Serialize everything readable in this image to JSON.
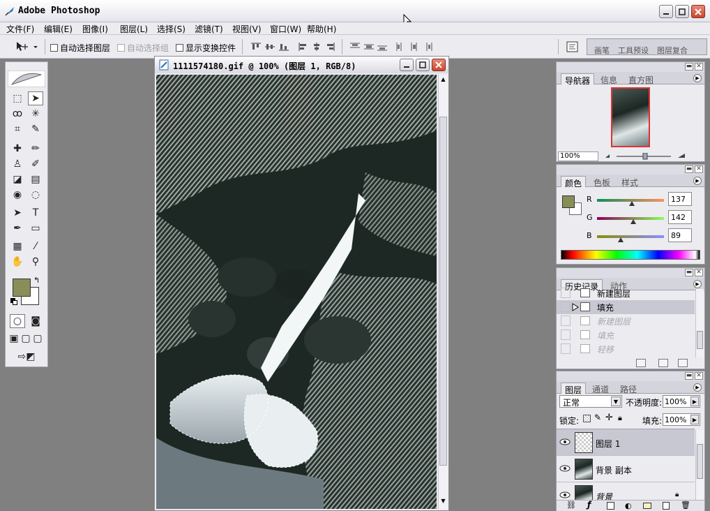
{
  "window": {
    "title": "Adobe Photoshop"
  },
  "menu": [
    "文件(F)",
    "编辑(E)",
    "图像(I)",
    "图层(L)",
    "选择(S)",
    "滤镜(T)",
    "视图(V)",
    "窗口(W)",
    "帮助(H)"
  ],
  "options": {
    "auto_select_layer": "自动选择图层",
    "auto_select_group": "自动选择组",
    "show_transform": "显示变换控件",
    "palette_well_tabs": [
      "画笔",
      "工具预设",
      "图层复合"
    ]
  },
  "document": {
    "title": "1111574180.gif @ 100% (图层 1, RGB/8)"
  },
  "navigator": {
    "tabs": [
      "导航器",
      "信息",
      "直方图"
    ],
    "zoom": "100%"
  },
  "color": {
    "tabs": [
      "颜色",
      "色板",
      "样式"
    ],
    "r_label": "R",
    "g_label": "G",
    "b_label": "B",
    "r": "137",
    "g": "142",
    "b": "89",
    "foreground": "#898e59",
    "background": "#ffffff"
  },
  "history": {
    "tabs": [
      "历史记录",
      "动作"
    ],
    "items": [
      {
        "label": "新建图层"
      },
      {
        "label": "填充"
      },
      {
        "label": "新建图层"
      },
      {
        "label": "填充"
      },
      {
        "label": "轻移"
      }
    ]
  },
  "layers": {
    "tabs": [
      "图层",
      "通道",
      "路径"
    ],
    "blend_mode": "正常",
    "opacity_label": "不透明度:",
    "opacity": "100%",
    "lock_label": "锁定:",
    "fill_label": "填充:",
    "fill": "100%",
    "items": [
      {
        "name": "图层 1"
      },
      {
        "name": "背景 副本"
      },
      {
        "name": "背景"
      }
    ]
  }
}
